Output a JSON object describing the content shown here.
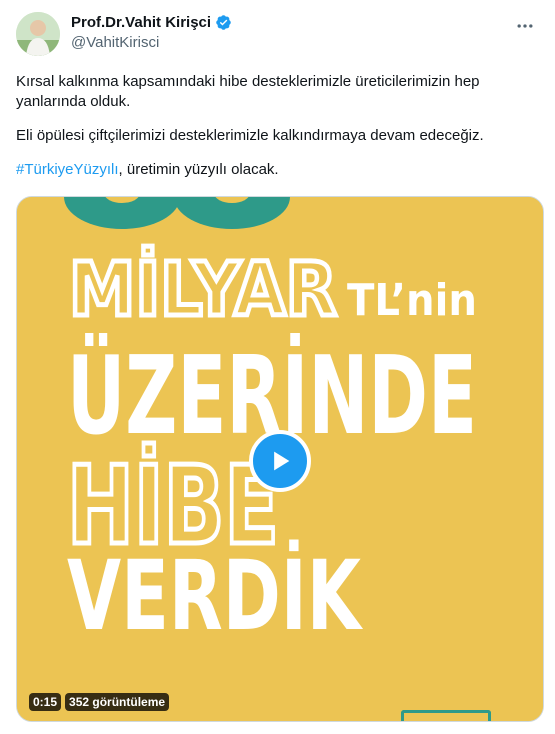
{
  "author": {
    "name": "Prof.Dr.Vahit Kirişci",
    "handle": "@VahitKirisci",
    "verified_icon": "verified-badge-icon",
    "avatar": "profile-avatar"
  },
  "post": {
    "paragraph1": "Kırsal kalkınma kapsamındaki hibe desteklerimizle üreticilerimizin hep yanlarında olduk.",
    "paragraph2": "Eli öpülesi çiftçilerimizi desteklerimizle kalkındırmaya devam edeceğiz.",
    "hashtag": "#TürkiyeYüzyılı",
    "paragraph3_rest": ", üretimin yüzyılı olacak."
  },
  "video": {
    "line_milyar": "MİLYAR",
    "line_tlnin": "TL’nin",
    "line_uzerinde": "ÜZERİNDE",
    "line_hibe": "HİBE",
    "line_verdik": "VERDİK",
    "duration": "0:15",
    "views": "352 görüntüleme",
    "play_icon": "play-icon"
  },
  "colors": {
    "accent": "#1d9bf0",
    "video_bg": "#ecc453",
    "teal": "#2e9a89"
  }
}
